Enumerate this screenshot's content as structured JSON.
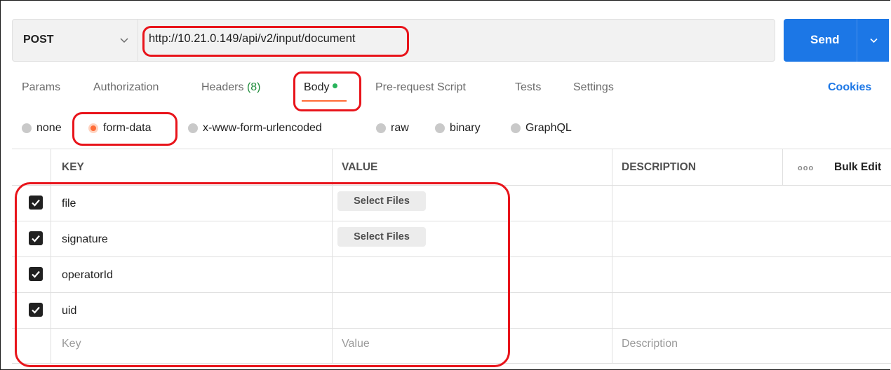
{
  "request": {
    "method": "POST",
    "url": "http://10.21.0.149/api/v2/input/document",
    "send_label": "Send"
  },
  "tabs": [
    {
      "label": "Params"
    },
    {
      "label": "Authorization"
    },
    {
      "label": "Headers",
      "count": "(8)"
    },
    {
      "label": "Body"
    },
    {
      "label": "Pre-request Script"
    },
    {
      "label": "Tests"
    },
    {
      "label": "Settings"
    }
  ],
  "cookies_label": "Cookies",
  "body_types": {
    "options": [
      "none",
      "form-data",
      "x-www-form-urlencoded",
      "raw",
      "binary",
      "GraphQL"
    ],
    "selected": "form-data"
  },
  "table": {
    "headers": {
      "key": "KEY",
      "value": "VALUE",
      "description": "DESCRIPTION",
      "more": "ooo",
      "bulk_edit": "Bulk Edit"
    },
    "rows": [
      {
        "key": "file",
        "value_button": "Select Files",
        "checked": true
      },
      {
        "key": "signature",
        "value_button": "Select Files",
        "checked": true
      },
      {
        "key": "operatorId",
        "value_button": "",
        "checked": true
      },
      {
        "key": "uid",
        "value_button": "",
        "checked": true
      }
    ],
    "placeholders": {
      "key": "Key",
      "value": "Value",
      "description": "Description"
    }
  },
  "colors": {
    "accent_orange": "#ff6c37",
    "send_blue": "#1c77e6",
    "annotation_red": "#e8141b"
  }
}
